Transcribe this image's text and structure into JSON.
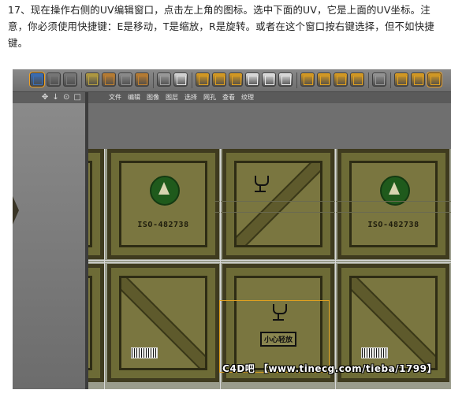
{
  "caption": {
    "text": "17、现在操作右侧的UV编辑窗口，点击左上角的图标。选中下面的UV，它是上面的UV坐标。注意，你必须使用快捷键：E是移动，T是缩放，R是旋转。或者在这个窗口按右键选择，但不如快捷键。"
  },
  "toolbar": {
    "buttons": [
      {
        "name": "uv-point-mode-icon",
        "color": "#3a6fb8",
        "selected": true
      },
      {
        "name": "uv-edge-mode-icon",
        "color": "#7a7a7a",
        "selected": false
      },
      {
        "name": "uv-poly-mode-icon",
        "color": "#7a7a7a",
        "selected": false
      },
      {
        "name": "texture-mode-icon",
        "color": "#b8a040",
        "selected": false
      },
      {
        "name": "checker-icon",
        "color": "#c08030",
        "selected": false
      },
      {
        "name": "grid-icon",
        "color": "#909090",
        "selected": false
      },
      {
        "name": "checker-mode-icon",
        "color": "#c08030",
        "selected": false
      },
      {
        "name": "grid-select-icon",
        "color": "#a0a0a0",
        "selected": false
      },
      {
        "name": "uv-close-icon",
        "color": "#e0e0e0",
        "selected": false
      },
      {
        "name": "edge-select-a-icon",
        "color": "#e0a020",
        "selected": false
      },
      {
        "name": "edge-select-b-icon",
        "color": "#e0a020",
        "selected": false
      },
      {
        "name": "edge-select-c-icon",
        "color": "#e0a020",
        "selected": false
      },
      {
        "name": "cross-a-icon",
        "color": "#e8e8e8",
        "selected": false
      },
      {
        "name": "cross-b-icon",
        "color": "#e8e8e8",
        "selected": false
      },
      {
        "name": "cross-c-icon",
        "color": "#e8e8e8",
        "selected": false
      },
      {
        "name": "uv-grid-a-icon",
        "color": "#e0a020",
        "selected": false
      },
      {
        "name": "uv-grid-b-icon",
        "color": "#e0a020",
        "selected": false
      },
      {
        "name": "uv-grid-c-icon",
        "color": "#e0a020",
        "selected": false
      },
      {
        "name": "uv-grid-d-icon",
        "color": "#e0a020",
        "selected": false
      },
      {
        "name": "transform-icon",
        "color": "#9a9a9a",
        "selected": false
      },
      {
        "name": "gear-a-icon",
        "color": "#e0a020",
        "selected": false
      },
      {
        "name": "gear-b-icon",
        "color": "#e0a020",
        "selected": false
      },
      {
        "name": "gear-c-icon",
        "color": "#e0a020",
        "selected": true
      }
    ]
  },
  "left_panel": {
    "icons": "✥ ↓ ⊙ □"
  },
  "uv_menu": {
    "items": [
      "文件",
      "编辑",
      "图像",
      "图层",
      "选择",
      "网孔",
      "查看",
      "纹理"
    ]
  },
  "texture": {
    "iso_label": "ISO-482738",
    "fragile_label": "小心轻放"
  },
  "watermark": {
    "text": "C4D吧 【www.tinecg.com/tieba/1799】"
  },
  "colors": {
    "selection": "#e0a020",
    "wire": "#d8d8d8"
  }
}
